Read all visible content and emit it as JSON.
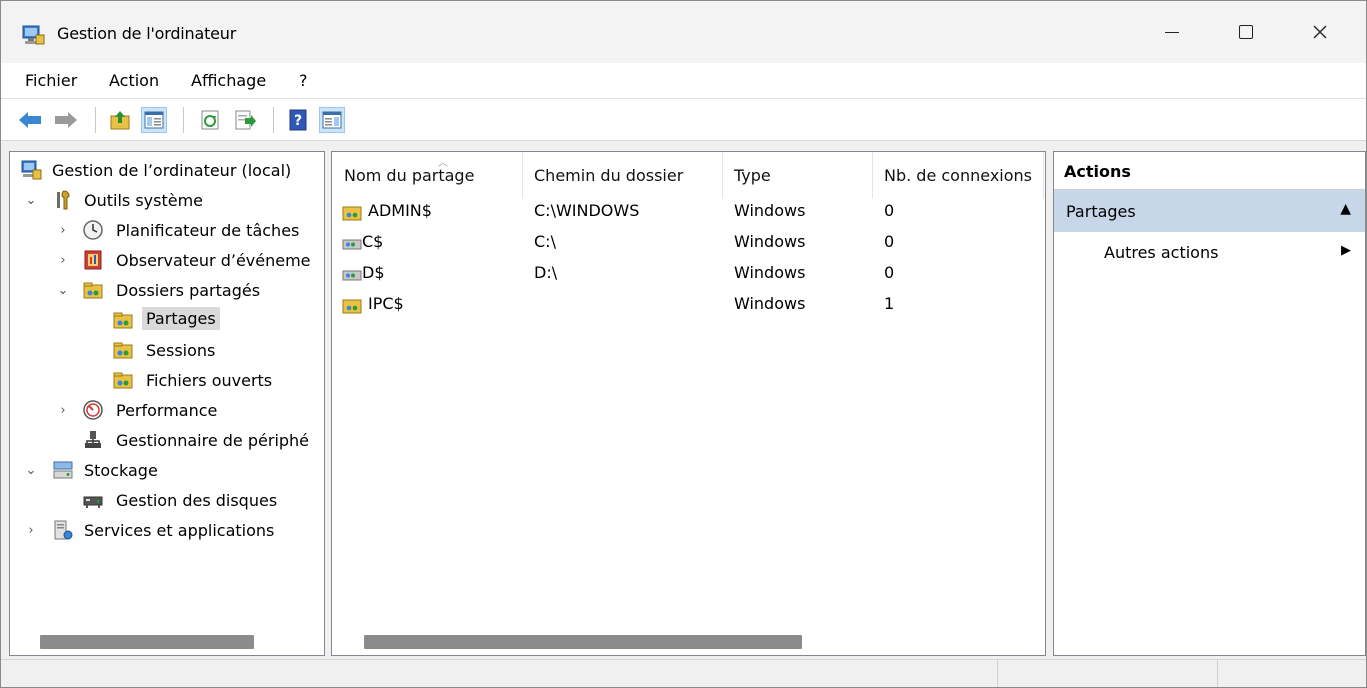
{
  "window": {
    "title": "Gestion de l'ordinateur",
    "minimize_label": "—",
    "maximize_label": "☐",
    "close_label": "✕"
  },
  "menu": {
    "items": [
      "Fichier",
      "Action",
      "Affichage",
      "?"
    ]
  },
  "toolbar": {
    "buttons": [
      "back-arrow-icon",
      "forward-arrow-icon",
      "up-folder-icon",
      "show-hide-tree-icon",
      "refresh-icon",
      "export-list-icon",
      "help-icon",
      "show-hide-action-pane-icon"
    ]
  },
  "tree": {
    "root": "Gestion de l’ordinateur (local)",
    "items": [
      {
        "label": "Outils système",
        "expanded": true
      },
      {
        "label": "Planificateur de tâches"
      },
      {
        "label": "Observateur d’événeme"
      },
      {
        "label": "Dossiers partagés",
        "expanded": true
      },
      {
        "label": "Partages",
        "selected": true
      },
      {
        "label": "Sessions"
      },
      {
        "label": "Fichiers ouverts"
      },
      {
        "label": "Performance"
      },
      {
        "label": "Gestionnaire de périphé"
      },
      {
        "label": "Stockage",
        "expanded": true
      },
      {
        "label": "Gestion des disques"
      },
      {
        "label": "Services et applications"
      }
    ]
  },
  "list": {
    "columns": [
      "Nom du partage",
      "Chemin du dossier",
      "Type",
      "Nb. de connexions"
    ],
    "rows": [
      {
        "name": "ADMIN$",
        "path": "C:\\WINDOWS",
        "type": "Windows",
        "connections": "0"
      },
      {
        "name": "C$",
        "path": "C:\\",
        "type": "Windows",
        "connections": "0"
      },
      {
        "name": "D$",
        "path": "D:\\",
        "type": "Windows",
        "connections": "0"
      },
      {
        "name": "IPC$",
        "path": "",
        "type": "Windows",
        "connections": "1"
      }
    ]
  },
  "actions": {
    "title": "Actions",
    "section": "Partages",
    "section_arrow": "▲",
    "more": "Autres actions",
    "more_arrow": "▶"
  },
  "colors": {
    "selection": "#c7d6e8",
    "tree_selection": "#dadada",
    "accent_blue": "#2b7bd3"
  }
}
